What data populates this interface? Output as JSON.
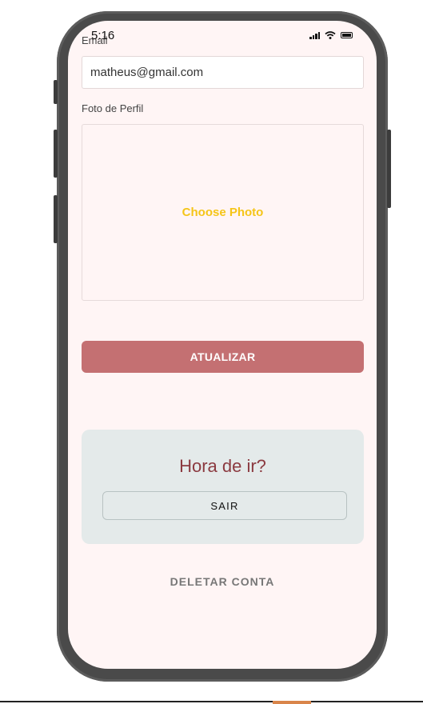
{
  "status_bar": {
    "time": "5:16",
    "icons": [
      "signal-icon",
      "wifi-icon",
      "battery-icon"
    ]
  },
  "form": {
    "email_label": "Email",
    "email_value": "matheus@gmail.com",
    "photo_label": "Foto de Perfil",
    "choose_photo_label": "Choose Photo",
    "update_button_label": "ATUALIZAR"
  },
  "logout_card": {
    "title": "Hora de ir?",
    "logout_button_label": "SAIR"
  },
  "delete_account_label": "DELETAR CONTA",
  "colors": {
    "background": "#fff5f5",
    "primary_button": "#c47072",
    "accent_yellow": "#f5c518",
    "card_background": "#e4eaea",
    "title_color": "#8b3a40"
  }
}
